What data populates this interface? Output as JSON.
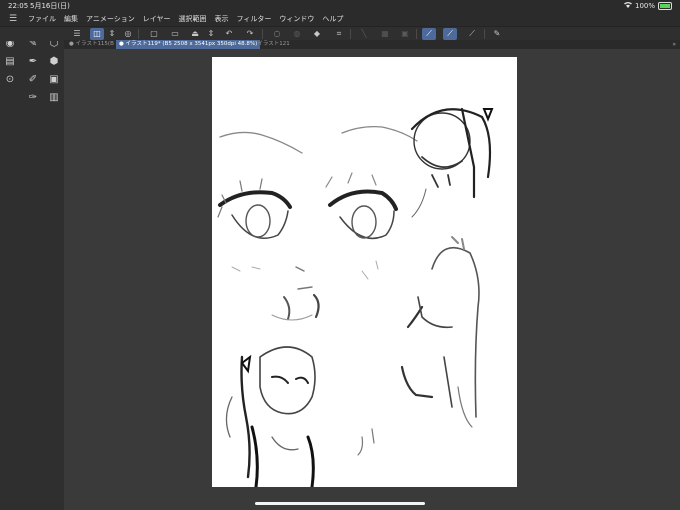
{
  "status": {
    "time": "22:05",
    "date": "5月16日(日)",
    "battery": "100%",
    "battery_level": 1.0
  },
  "menu": [
    "ファイル",
    "編集",
    "アニメーション",
    "レイヤー",
    "選択範囲",
    "表示",
    "フィルター",
    "ウィンドウ",
    "ヘルプ"
  ],
  "tabs": [
    "● イラスト115(B",
    "● イラスト119* (B5 2508 x 3541px 350dpi 48.8%)",
    "✕ イラスト121"
  ],
  "left_header": {
    "collapse": "«",
    "expand": "»"
  },
  "icons": {
    "app": "wifi-app-icon",
    "menu": "hamburger-icon"
  }
}
